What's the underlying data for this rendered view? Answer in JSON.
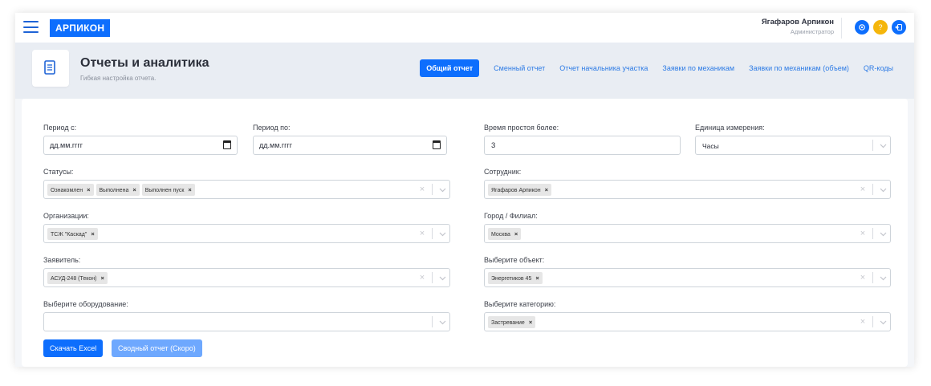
{
  "topbar": {
    "brand": "АРПИКОН",
    "user_name": "Ягафаров Арпикон",
    "user_role": "Администратор",
    "actions": [
      {
        "icon": "gear-icon",
        "color": "#0d6efd"
      },
      {
        "icon": "help-icon",
        "label": "?",
        "color": "#f5b60b"
      },
      {
        "icon": "logout-icon",
        "color": "#0d6efd"
      }
    ]
  },
  "page": {
    "title": "Отчеты и аналитика",
    "subtitle": "Гибкая настройка отчета."
  },
  "tabs": [
    "Общий отчет",
    "Сменный отчет",
    "Отчет начальника участка",
    "Заявки по механикам",
    "Заявки по механикам (объем)",
    "QR-коды"
  ],
  "active_tab": "Общий отчет",
  "form": {
    "period_from": {
      "label": "Период с:",
      "placeholder": "дд.мм.гггг"
    },
    "period_to": {
      "label": "Период по:",
      "placeholder": "дд.мм.гггг"
    },
    "downtime": {
      "label": "Время простоя более:",
      "value": "3"
    },
    "unit": {
      "label": "Единица измерения:",
      "value": "Часы"
    },
    "statuses": {
      "label": "Статусы:",
      "tags": [
        "Ознакомлен",
        "Выполнена",
        "Выполнен пуск"
      ]
    },
    "employee": {
      "label": "Сотрудник:",
      "tags": [
        "Ягафаров Арпикон"
      ]
    },
    "organizations": {
      "label": "Организации:",
      "tags": [
        "ТСЖ \"Каскад\""
      ]
    },
    "city": {
      "label": "Город / Филиал:",
      "tags": [
        "Москва"
      ]
    },
    "applicant": {
      "label": "Заявитель:",
      "tags": [
        "АСУД-248 (Текон)"
      ]
    },
    "object": {
      "label": "Выберите объект:",
      "tags": [
        "Энергетиков 45"
      ]
    },
    "equipment": {
      "label": "Выберите оборудование:",
      "tags": []
    },
    "category": {
      "label": "Выберите категорию:",
      "tags": [
        "Застревание"
      ]
    }
  },
  "buttons": {
    "download_excel": "Скачать Excel",
    "summary_report": "Сводный отчет (Скоро)"
  },
  "glyphs": {
    "tag_remove": "×",
    "clear": "×"
  },
  "colors": {
    "primary": "#0d6efd",
    "disabled": "#6ea8fe",
    "warning": "#f5b60b"
  }
}
